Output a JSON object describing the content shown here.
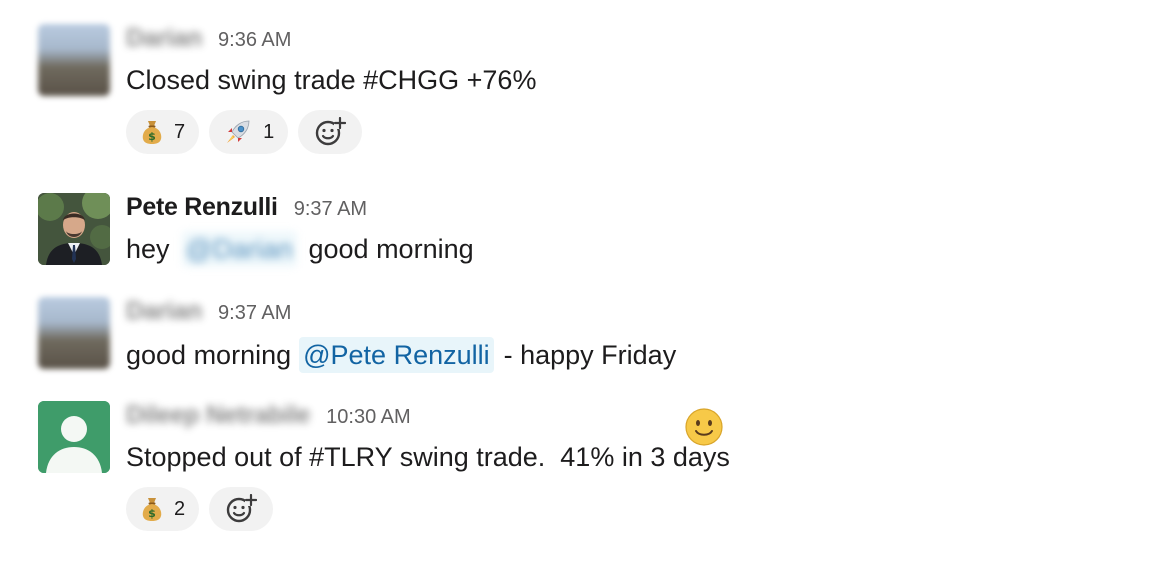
{
  "messages": [
    {
      "author": "Darian",
      "time": "9:36 AM",
      "text": "Closed swing trade #CHGG +76%",
      "reactions": [
        {
          "emoji": "money-bag-icon",
          "count": "7"
        },
        {
          "emoji": "rocket-icon",
          "count": "1"
        }
      ]
    },
    {
      "author": "Pete Renzulli",
      "time": "9:37 AM",
      "text_before": "hey",
      "mention": "@Darian",
      "text_after": "good morning"
    },
    {
      "author": "Darian",
      "time": "9:37 AM",
      "text_before": "good morning",
      "mention": "@Pete Renzulli",
      "text_after": "- happy Friday",
      "emoji": "slightly-smiling-face-icon"
    },
    {
      "author": "Dileep Netrabile",
      "time": "10:30 AM",
      "text": "Stopped out of #TLRY swing trade.  41% in 3 days",
      "reactions": [
        {
          "emoji": "money-bag-icon",
          "count": "2"
        }
      ]
    }
  ],
  "colors": {
    "mention_bg": "#e8f5fa",
    "mention_text": "#1264a3",
    "reaction_bg": "#f2f2f2",
    "avatar_generic": "#3f9c6a"
  }
}
